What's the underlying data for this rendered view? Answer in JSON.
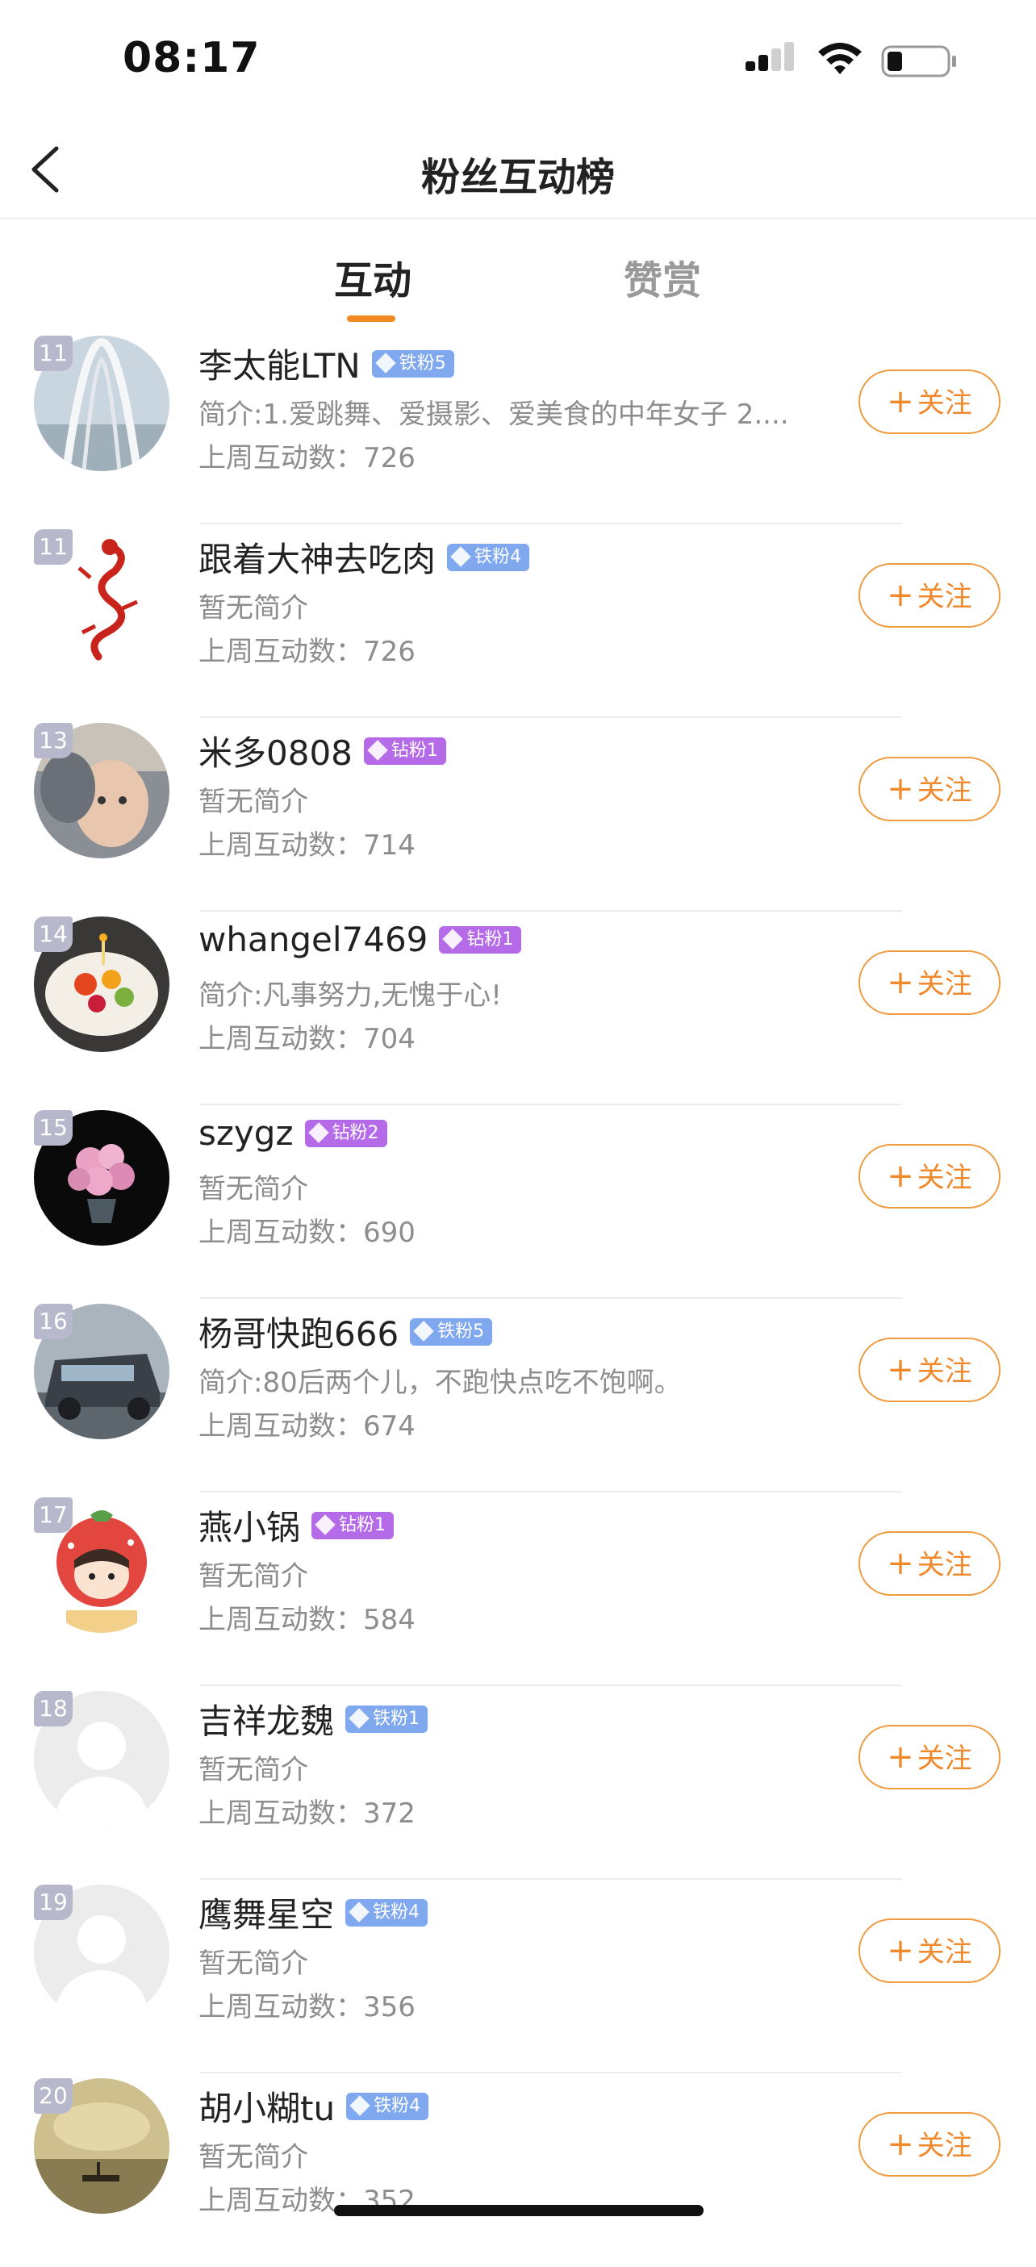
{
  "status_bar": {
    "time": "08:17"
  },
  "nav": {
    "title": "粉丝互动榜"
  },
  "tabs": [
    {
      "label": "互动",
      "active": true
    },
    {
      "label": "赞赏",
      "active": false
    }
  ],
  "colors": {
    "accent": "#f08a24",
    "iron_badge": "#7fa8ee",
    "diamond_badge": "#b56be8"
  },
  "count_prefix": "上周互动数：",
  "follow_label": "关注",
  "follow_plus": "+",
  "fans": [
    {
      "rank": "11",
      "name": "李太能LTN",
      "badge": "铁粉5",
      "badge_type": "iron",
      "intro": "简介:1.爱跳舞、爱摄影、爱美食的中年女子 2....",
      "count": "726",
      "avatar": "bridge-photo"
    },
    {
      "rank": "11",
      "name": "跟着大神去吃肉",
      "badge": "铁粉4",
      "badge_type": "iron",
      "intro": "暂无简介",
      "count": "726",
      "avatar": "red-dragon-papercut"
    },
    {
      "rank": "13",
      "name": "米多0808",
      "badge": "钻粉1",
      "badge_type": "diamond",
      "intro": "暂无简介",
      "count": "714",
      "avatar": "child-photo"
    },
    {
      "rank": "14",
      "name": "whangel7469",
      "badge": "钻粉1",
      "badge_type": "diamond",
      "intro": "简介:凡事努力,无愧于心!",
      "count": "704",
      "avatar": "fruit-cake-photo"
    },
    {
      "rank": "15",
      "name": "szygz",
      "badge": "钻粉2",
      "badge_type": "diamond",
      "intro": "暂无简介",
      "count": "690",
      "avatar": "pink-roses-photo"
    },
    {
      "rank": "16",
      "name": "杨哥快跑666",
      "badge": "铁粉5",
      "badge_type": "iron",
      "intro": "简介:80后两个儿，不跑快点吃不饱啊。",
      "count": "674",
      "avatar": "van-photo"
    },
    {
      "rank": "17",
      "name": "燕小锅",
      "badge": "钻粉1",
      "badge_type": "diamond",
      "intro": "暂无简介",
      "count": "584",
      "avatar": "strawberry-cartoon"
    },
    {
      "rank": "18",
      "name": "吉祥龙魏",
      "badge": "铁粉1",
      "badge_type": "iron",
      "intro": "暂无简介",
      "count": "372",
      "avatar": "default-avatar"
    },
    {
      "rank": "19",
      "name": "鹰舞星空",
      "badge": "铁粉4",
      "badge_type": "iron",
      "intro": "暂无简介",
      "count": "356",
      "avatar": "default-avatar"
    },
    {
      "rank": "20",
      "name": "胡小糊tu",
      "badge": "铁粉4",
      "badge_type": "iron",
      "intro": "暂无简介",
      "count": "352",
      "avatar": "misty-lake-photo"
    }
  ]
}
